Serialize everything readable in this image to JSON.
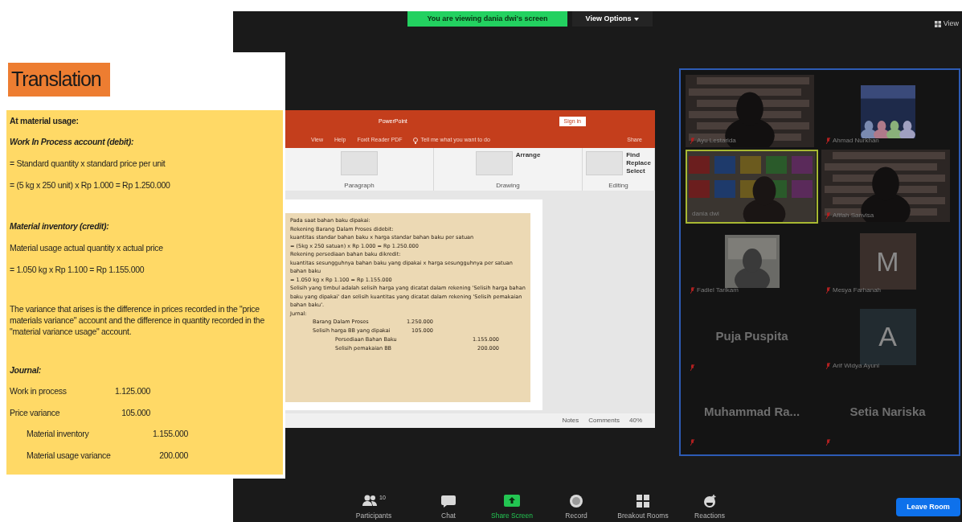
{
  "translation_panel": {
    "title": "Translation",
    "sections": [
      {
        "lines": [
          {
            "kind": "bold",
            "text": "At material usage:"
          },
          {
            "kind": "heading",
            "text": "Work In Process account (debit):"
          },
          {
            "kind": "text",
            "text": "= Standard quantity x standard price per unit"
          },
          {
            "kind": "text",
            "text": "= (5 kg x 250 unit) x Rp 1.000 = Rp 1.250.000"
          }
        ]
      },
      {
        "lines": [
          {
            "kind": "heading",
            "text": "Material inventory (credit):"
          },
          {
            "kind": "text",
            "text": "Material usage actual quantity x actual price"
          },
          {
            "kind": "text",
            "text": "= 1.050 kg x Rp 1.100 = Rp 1.155.000"
          }
        ]
      },
      {
        "lines": [
          {
            "kind": "paragraph",
            "text": "The variance that arises is the difference in prices recorded in the \"price materials variance\" account and the difference in quantity recorded in the \"material variance usage\" account."
          }
        ]
      },
      {
        "lines": [
          {
            "kind": "heading",
            "text": "Journal:"
          }
        ]
      }
    ],
    "journal": [
      {
        "kind": "debit",
        "label": "Work in process",
        "amount": "1.125.000"
      },
      {
        "kind": "debit",
        "label": "Price variance",
        "amount": "105.000"
      },
      {
        "kind": "credit",
        "label": "Material inventory",
        "amount": "1.155.000"
      },
      {
        "kind": "credit",
        "label": "Material usage variance",
        "amount": "200.000"
      }
    ]
  },
  "top_bar": {
    "viewing_banner": "You are viewing dania dwi's screen",
    "view_options": "View Options",
    "view": "View"
  },
  "powerpoint": {
    "title": "PowerPoint",
    "sign_in": "Sign in",
    "menu_tabs": [
      "View",
      "Help",
      "Foxit Reader PDF"
    ],
    "tell_me": "Tell me what you want to do",
    "share": "Share",
    "ribbon_groups": [
      {
        "label": "Paragraph"
      },
      {
        "label": "Drawing",
        "buttons": [
          "Arrange"
        ]
      },
      {
        "label": "Editing",
        "buttons": [
          "Find",
          "Replace",
          "Select"
        ]
      }
    ],
    "slide": {
      "lines": [
        "Pada saat bahan baku dipakai:",
        "Rekening Barang Dalam Proses didebit:",
        "kuantitas standar bahan baku x harga standar bahan baku per satuan",
        "= (5kg x 250 satuan) x Rp 1.000 = Rp 1.250.000",
        "Rekening persediaan bahan baku dikredit:",
        "kuantitas sesungguhnya bahan baku yang dipakai x harga sesungguhnya per satuan bahan baku",
        "= 1.050 kg x Rp 1.100 = Rp 1.155.000",
        "Selisih yang timbul adalah selisih harga yang dicatat dalam rekening 'Selisih harga bahan baku yang dipakai' dan selisih kuantitas yang dicatat dalam rekening 'Selisih pemakaian bahan baku'.",
        "Jurnal:"
      ],
      "journal": [
        {
          "kind": "debit",
          "label": "Barang Dalam Proses",
          "amount": "1.250.000"
        },
        {
          "kind": "debit",
          "label": "Selisih harga BB yang dipakai",
          "amount": "105.000"
        },
        {
          "kind": "credit",
          "label": "Persediaan Bahan Baku",
          "amount": "1.155.000"
        },
        {
          "kind": "credit",
          "label": "Selisih pemakaian BB",
          "amount": "200.000"
        }
      ]
    },
    "status_bar": [
      "Notes",
      "Comments",
      "40%"
    ]
  },
  "gallery": [
    {
      "kind": "video",
      "name": "Ayu Lestarida",
      "muted": true,
      "active_speaker": false
    },
    {
      "name": "Ahmad Nurkhan",
      "muted": true,
      "active_speaker": false
    },
    {
      "kind": "video",
      "name": "dania dwi",
      "muted": false,
      "active_speaker": true
    },
    {
      "kind": "video",
      "name": "Afifah Sanvisa",
      "muted": true,
      "active_speaker": false
    },
    {
      "name": "Fadiel Tarikam",
      "muted": true,
      "active_speaker": false
    },
    {
      "kind": "avatar",
      "initial": "M",
      "color": "#3a2f2b",
      "name": "Mesya Farhanah",
      "muted": true,
      "active_speaker": false
    },
    {
      "kind": "name",
      "name": "Puja Puspita",
      "muted": true,
      "active_speaker": false
    },
    {
      "kind": "avatar",
      "initial": "A",
      "color": "#222b30",
      "name": "Arif Widya Ayuni",
      "muted": true,
      "active_speaker": false
    },
    {
      "kind": "name",
      "name": "Muhammad  Ra...",
      "muted": true,
      "active_speaker": false
    },
    {
      "kind": "name",
      "name": "Setia Nariska",
      "muted": true,
      "active_speaker": false
    }
  ],
  "toolbar": [
    {
      "kind": "participants",
      "label": "Participants",
      "count": "10"
    },
    {
      "kind": "chat",
      "label": "Chat"
    },
    {
      "kind": "share",
      "label": "Share Screen"
    },
    {
      "kind": "record",
      "label": "Record"
    },
    {
      "kind": "breakout",
      "label": "Breakout Rooms"
    },
    {
      "kind": "reactions",
      "label": "Reactions"
    }
  ],
  "leave_button": "Leave Room"
}
